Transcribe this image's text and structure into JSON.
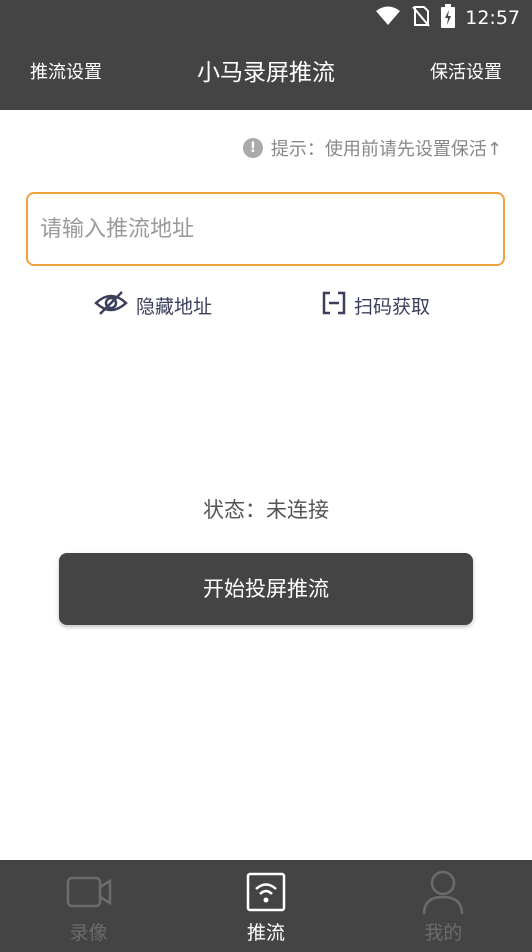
{
  "status_bar": {
    "time": "12:57",
    "icons": [
      "wifi-icon",
      "no-sim-icon",
      "battery-charging-icon"
    ]
  },
  "app_bar": {
    "left_action": "推流设置",
    "title": "小马录屏推流",
    "right_action": "保活设置"
  },
  "hint": {
    "text": "提示：使用前请先设置保活↑",
    "icon": "info-icon"
  },
  "stream_url": {
    "value": "",
    "placeholder": "请输入推流地址"
  },
  "actions": {
    "hide_address": "隐藏地址",
    "scan_get": "扫码获取"
  },
  "status": {
    "text": "状态：未连接"
  },
  "start_button": {
    "label": "开始投屏推流"
  },
  "tabs": [
    {
      "label": "录像",
      "icon": "video-camera-icon",
      "active": false
    },
    {
      "label": "推流",
      "icon": "wifi-broadcast-icon",
      "active": true
    },
    {
      "label": "我的",
      "icon": "person-icon",
      "active": false
    }
  ],
  "colors": {
    "bar_background": "#444444",
    "input_border_accent": "#f0a23c",
    "action_text": "#3a3f5c",
    "inactive_tab": "#6b6b6b"
  }
}
